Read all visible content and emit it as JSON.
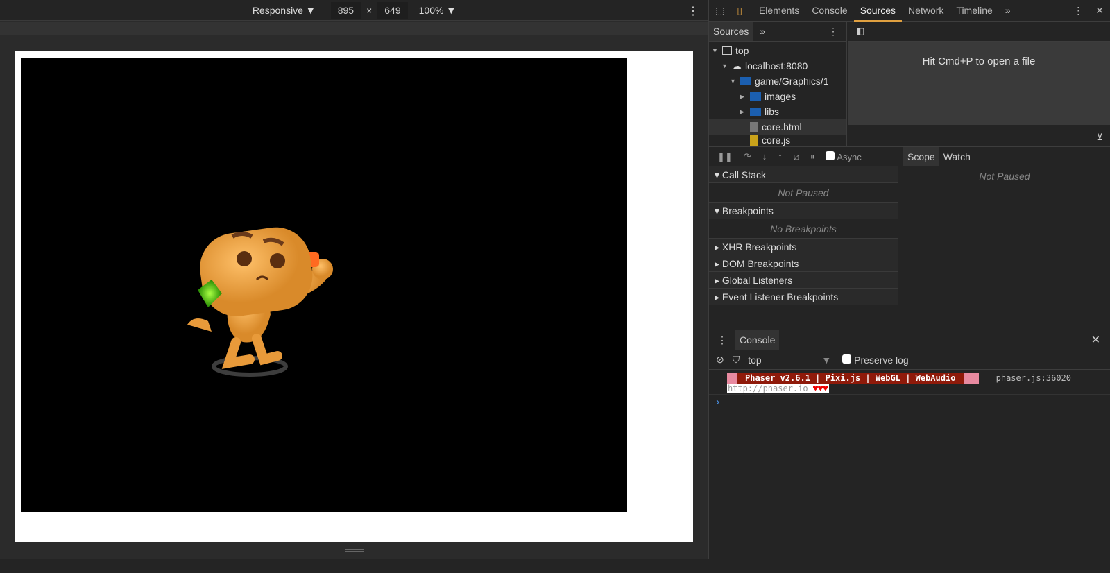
{
  "device_toolbar": {
    "device": "Responsive",
    "width": "895",
    "times": "×",
    "height": "649",
    "zoom": "100%"
  },
  "devtools": {
    "tabs": [
      {
        "label": "Elements"
      },
      {
        "label": "Console"
      },
      {
        "label": "Sources"
      },
      {
        "label": "Network"
      },
      {
        "label": "Timeline"
      }
    ],
    "more": "»",
    "active_tab": "Sources",
    "accent": "#e0a040",
    "navigator": {
      "tab": "Sources",
      "tree": [
        {
          "label": "top",
          "depth": 0,
          "type": "frame",
          "expanded": true
        },
        {
          "label": "localhost:8080",
          "depth": 1,
          "type": "cloud",
          "expanded": true
        },
        {
          "label": "game/Graphics/1",
          "depth": 2,
          "type": "folder",
          "expanded": true
        },
        {
          "label": "images",
          "depth": 3,
          "type": "folder",
          "expanded": false
        },
        {
          "label": "libs",
          "depth": 3,
          "type": "folder",
          "expanded": false
        },
        {
          "label": "core.html",
          "depth": 3,
          "type": "file-html"
        },
        {
          "label": "core.js",
          "depth": 3,
          "type": "file-js"
        }
      ]
    },
    "editor_hint": "Hit Cmd+P to open a file",
    "debugger": {
      "async_label": "Async",
      "sections": {
        "call_stack": "Call Stack",
        "call_stack_empty": "Not Paused",
        "breakpoints": "Breakpoints",
        "breakpoints_empty": "No Breakpoints",
        "xhr": "XHR Breakpoints",
        "dom": "DOM Breakpoints",
        "global": "Global Listeners",
        "event": "Event Listener Breakpoints"
      },
      "scope_tab": "Scope",
      "watch_tab": "Watch",
      "scope_empty": "Not Paused"
    },
    "console": {
      "tab": "Console",
      "context": "top",
      "preserve_log": "Preserve log",
      "banner": "Phaser v2.6.1 | Pixi.js | WebGL | WebAudio",
      "source": "phaser.js:36020",
      "link": "http://phaser.io",
      "hearts": "♥♥♥",
      "prompt": "›"
    }
  }
}
